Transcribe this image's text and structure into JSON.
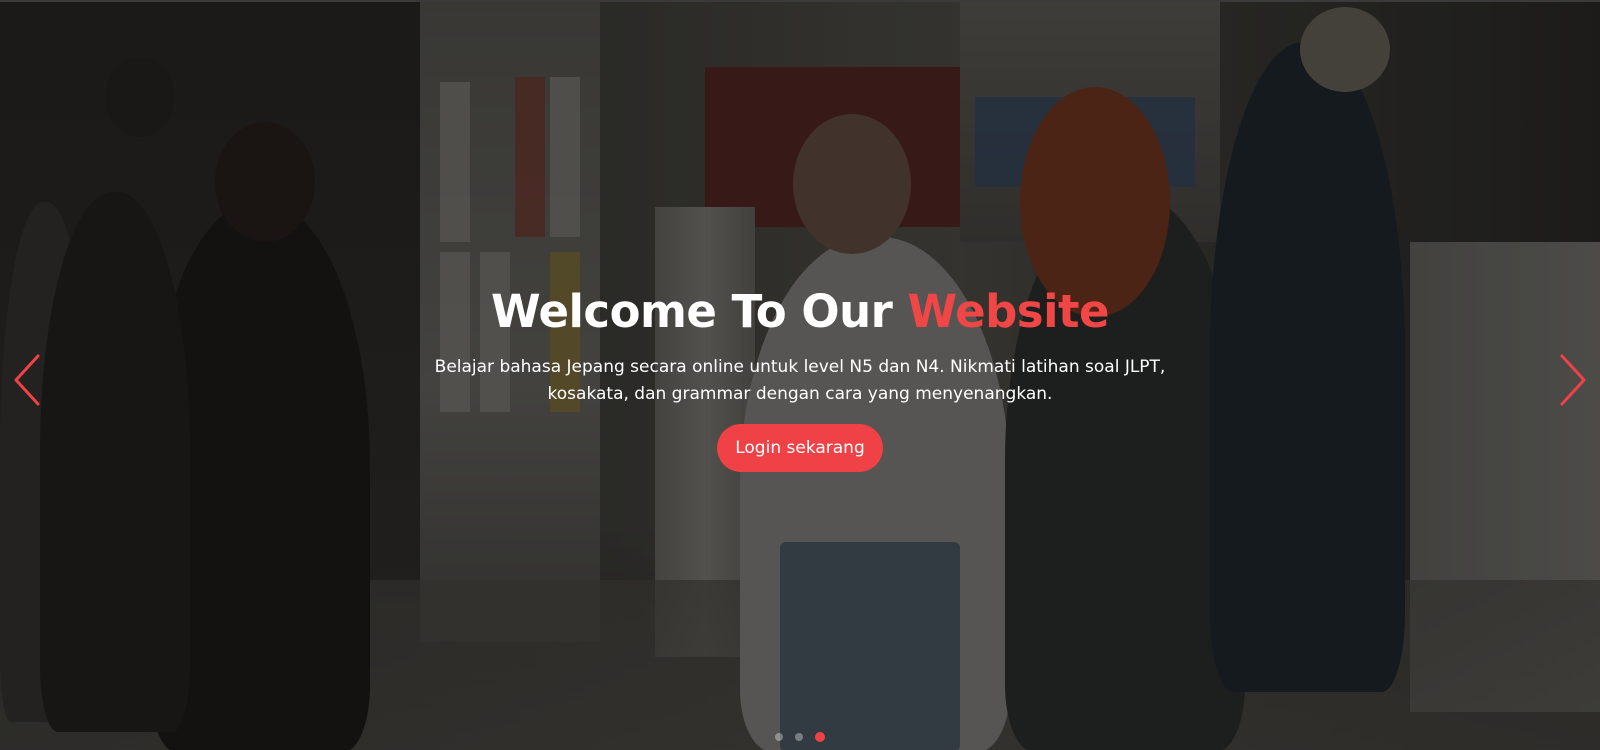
{
  "hero": {
    "title_main": "Welcome To Our",
    "title_accent": "Website",
    "subtitle_line1": "Belajar bahasa Jepang secara online untuk level N5 dan N4. Nikmati latihan soal JLPT,",
    "subtitle_line2": "kosakata, dan grammar dengan cara yang menyenangkan.",
    "cta_label": "Login sekarang"
  },
  "carousel": {
    "prev_icon": "chevron-left-icon",
    "next_icon": "chevron-right-icon",
    "slide_count": 3,
    "active_index": 2
  },
  "colors": {
    "accent": "#f04246",
    "text": "#ffffff",
    "overlay": "rgba(0,0,0,0.38)"
  }
}
